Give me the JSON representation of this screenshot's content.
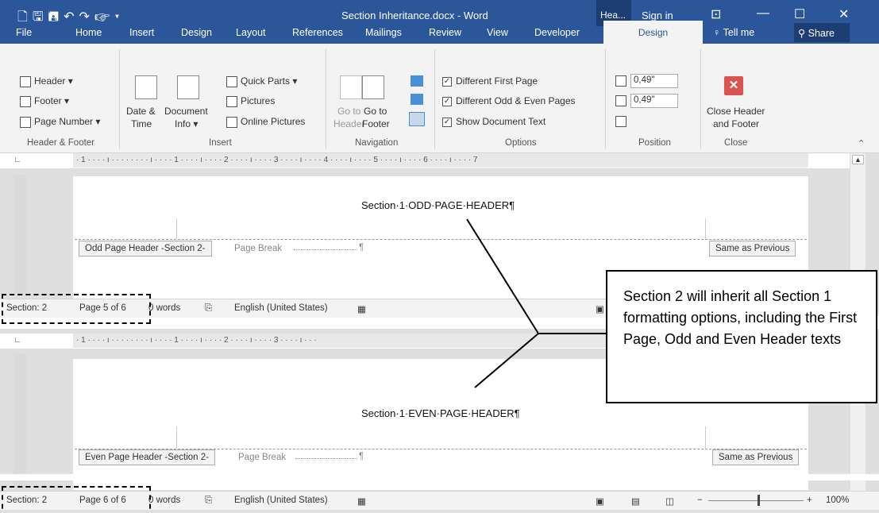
{
  "window": {
    "title": "Section Inheritance.docx - Word",
    "context_tab": "Hea...",
    "sign_in": "Sign in",
    "restore_icon": "ribbon-display-icon",
    "qat_icons": [
      "new-doc-icon",
      "save-icon",
      "save-as-icon",
      "undo-icon",
      "redo-icon",
      "touch-mode-icon",
      "customize-icon"
    ]
  },
  "tabs": [
    "File",
    "Home",
    "Insert",
    "Design",
    "Layout",
    "References",
    "Mailings",
    "Review",
    "View",
    "Developer"
  ],
  "active_tab": "Design",
  "tell_me": "Tell me",
  "share": "Share",
  "ribbon": {
    "header_footer": {
      "header": "Header",
      "footer": "Footer",
      "page_number": "Page Number",
      "group": "Header & Footer"
    },
    "insert": {
      "date_time_1": "Date &",
      "date_time_2": "Time",
      "doc_info_1": "Document",
      "doc_info_2": "Info",
      "quick_parts": "Quick Parts",
      "pictures": "Pictures",
      "online_pictures": "Online Pictures",
      "group": "Insert"
    },
    "navigation": {
      "goto_header_1": "Go to",
      "goto_header_2": "Header",
      "goto_footer_1": "Go to",
      "goto_footer_2": "Footer",
      "group": "Navigation"
    },
    "options": {
      "first_page": "Different First Page",
      "odd_even": "Different Odd & Even Pages",
      "show_doc": "Show Document Text",
      "group": "Options",
      "first_page_checked": true,
      "odd_even_checked": true,
      "show_doc_checked": true
    },
    "position": {
      "header_pos": "0,49\"",
      "footer_pos": "0,49\"",
      "group": "Position"
    },
    "close": {
      "label_1": "Close Header",
      "label_2": "and Footer",
      "group": "Close"
    }
  },
  "ruler": {
    "marks": "· 1 · · · · ı · · · ·   · · · · ı · · · · 1 · · · · ı · · · · 2 · · · · ı · · · · 3 · · · · ı · · · · 4 · · · · ı · · · · 5 · · · · ı · · · · 6 · · · · ı · · · · 7",
    "marks_short": "· 1 · · · · ı · · · ·   · · · · ı · · · · 1 · · · · ı · · · · 2 · · · · ı · · · · 3 · · · · ı · · ·"
  },
  "pane1": {
    "header_text": "Section·1·ODD·PAGE·HEADER¶",
    "tag_left": "Odd Page Header -Section 2-",
    "page_break": "Page Break",
    "pilcrow": "¶",
    "tag_right": "Same as Previous",
    "status": {
      "section": "Section: 2",
      "page": "Page 5 of 6",
      "words": "0 words",
      "language": "English (United States)"
    }
  },
  "pane2": {
    "header_text": "Section·1·EVEN·PAGE·HEADER¶",
    "tag_left": "Even Page Header -Section 2-",
    "page_break": "Page Break",
    "pilcrow": "¶",
    "tag_right": "Same as Previous",
    "status": {
      "section": "Section: 2",
      "page": "Page 6 of 6",
      "words": "0 words",
      "language": "English (United States)",
      "zoom": "100%"
    }
  },
  "callout": {
    "text": "Section 2 will inherit all Section 1 formatting options, including the First Page, Odd and Even Header texts"
  }
}
